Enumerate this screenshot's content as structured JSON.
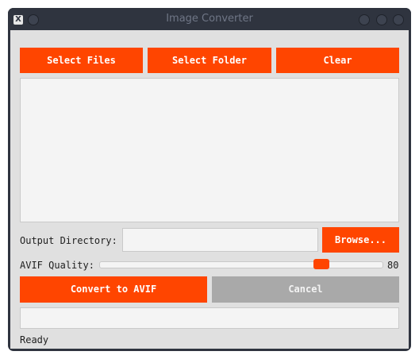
{
  "window": {
    "title": "Image Converter",
    "app_icon_glyph": "X",
    "app_icon_name": "x-window-icon"
  },
  "toolbar": {
    "select_files_label": "Select Files",
    "select_folder_label": "Select Folder",
    "clear_label": "Clear"
  },
  "file_list": {
    "items": []
  },
  "output": {
    "label": "Output Directory:",
    "value": "",
    "browse_label": "Browse..."
  },
  "quality": {
    "label": "AVIF Quality:",
    "value": 80,
    "value_text": "80",
    "min": 0,
    "max": 100
  },
  "actions": {
    "convert_label": "Convert to AVIF",
    "cancel_label": "Cancel",
    "cancel_enabled": false
  },
  "progress": {
    "value": 0
  },
  "status": {
    "text": "Ready"
  },
  "colors": {
    "accent": "#ff4500",
    "disabled": "#a9a9a9",
    "background": "#e0e0e0",
    "titlebar": "#2f343f"
  }
}
